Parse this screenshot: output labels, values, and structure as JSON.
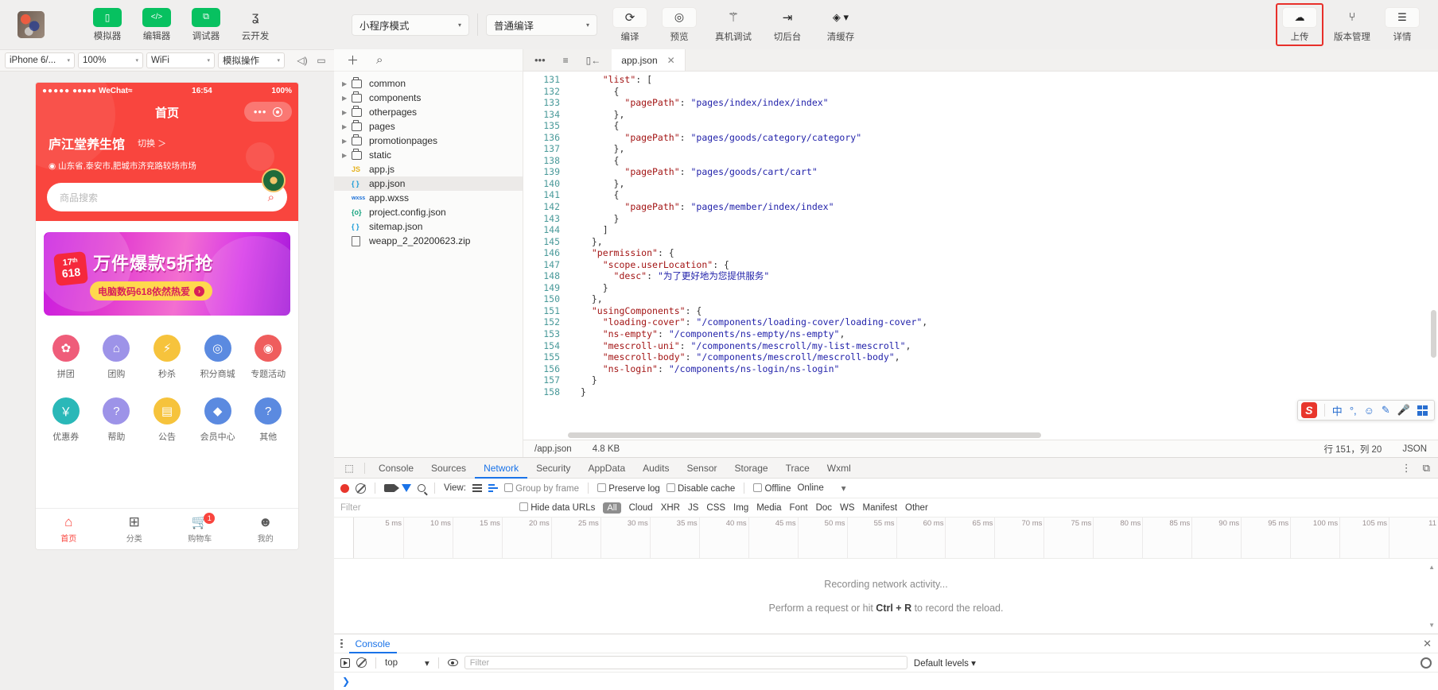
{
  "toolbar": {
    "left_tools": [
      {
        "label": "模拟器",
        "icon": "phone-icon",
        "glyph": "▯",
        "style": "green"
      },
      {
        "label": "编辑器",
        "icon": "code-icon",
        "glyph": "</>",
        "style": "green"
      },
      {
        "label": "调试器",
        "icon": "debugger-icon",
        "glyph": "⧉",
        "style": "green"
      },
      {
        "label": "云开发",
        "icon": "cloud-dev-icon",
        "glyph": "ʓ",
        "style": "plain"
      }
    ],
    "mode_select": {
      "value": "小程序模式",
      "caret": "▾"
    },
    "compile_select": {
      "value": "普通编译",
      "caret": "▾"
    },
    "mid_tools": [
      {
        "label": "编译",
        "icon": "refresh-icon",
        "glyph": "⟳"
      },
      {
        "label": "预览",
        "icon": "eye-icon",
        "glyph": "◎"
      },
      {
        "label": "真机调试",
        "icon": "bug-icon",
        "glyph": "⚚"
      },
      {
        "label": "切后台",
        "icon": "background-icon",
        "glyph": "⇥"
      },
      {
        "label": "清缓存",
        "icon": "layers-icon",
        "glyph": "◈ ▾"
      }
    ],
    "right_tools": [
      {
        "label": "上传",
        "icon": "upload-cloud-icon",
        "glyph": "☁",
        "highlighted": true
      },
      {
        "label": "版本管理",
        "icon": "branch-icon",
        "glyph": "⑂"
      },
      {
        "label": "详情",
        "icon": "menu-icon",
        "glyph": "☰"
      }
    ],
    "highlight_color": "#e8302a"
  },
  "simulator": {
    "controls": [
      {
        "value": "iPhone 6/...",
        "name": "device-select"
      },
      {
        "value": "100%",
        "name": "zoom-select"
      },
      {
        "value": "WiFi",
        "name": "network-select"
      },
      {
        "value": "模拟操作",
        "name": "simulate-action-select"
      }
    ],
    "icons": [
      "volume-icon",
      "screen-icon"
    ],
    "phone": {
      "status": {
        "carrier": "●●●●● WeChat",
        "wifi": "≈",
        "time": "16:54",
        "battery": "100%"
      },
      "nav_title": "首页",
      "shop_name": "庐江堂养生馆",
      "switch_label": "切换 ＞",
      "address": "山东省,泰安市,肥城市济兖路较场市场",
      "search_placeholder": "商品搜索",
      "banner": {
        "badge_top": "17ᵗʰ",
        "badge_bottom": "618",
        "main": "万件爆款5折抢",
        "sub": "电脑数码618依然热爱"
      },
      "grid": [
        {
          "label": "拼团",
          "color": "#ef5d7a",
          "glyph": "✿"
        },
        {
          "label": "团购",
          "color": "#9d93e8",
          "glyph": "⌂"
        },
        {
          "label": "秒杀",
          "color": "#f6c33c",
          "glyph": "⚡"
        },
        {
          "label": "积分商城",
          "color": "#5b8ae0",
          "glyph": "◎"
        },
        {
          "label": "专题活动",
          "color": "#ef5d5d",
          "glyph": "◉"
        },
        {
          "label": "优惠券",
          "color": "#2ab8b8",
          "glyph": "￥"
        },
        {
          "label": "帮助",
          "color": "#9d93e8",
          "glyph": "?"
        },
        {
          "label": "公告",
          "color": "#f6c33c",
          "glyph": "▤"
        },
        {
          "label": "会员中心",
          "color": "#5b8ae0",
          "glyph": "◆"
        },
        {
          "label": "其他",
          "color": "#5b8ae0",
          "glyph": "?"
        }
      ],
      "tabbar": [
        {
          "label": "首页",
          "glyph": "⌂",
          "active": true,
          "badge": null
        },
        {
          "label": "分类",
          "glyph": "⊞",
          "active": false,
          "badge": null
        },
        {
          "label": "购物车",
          "glyph": "🛒",
          "active": false,
          "badge": "1"
        },
        {
          "label": "我的",
          "glyph": "☻",
          "active": false,
          "badge": null
        }
      ],
      "accent": "#f9453e"
    }
  },
  "file_tree": {
    "bar_icons": [
      "add-icon",
      "search-icon"
    ],
    "items": [
      {
        "name": "common",
        "type": "folder"
      },
      {
        "name": "components",
        "type": "folder"
      },
      {
        "name": "otherpages",
        "type": "folder"
      },
      {
        "name": "pages",
        "type": "folder"
      },
      {
        "name": "promotionpages",
        "type": "folder"
      },
      {
        "name": "static",
        "type": "folder"
      },
      {
        "name": "app.js",
        "type": "js",
        "badge": "JS"
      },
      {
        "name": "app.json",
        "type": "json",
        "badge": "{ }",
        "selected": true
      },
      {
        "name": "app.wxss",
        "type": "wxss",
        "badge": "wxss"
      },
      {
        "name": "project.config.json",
        "type": "config",
        "badge": "{o}"
      },
      {
        "name": "sitemap.json",
        "type": "json",
        "badge": "{ }"
      },
      {
        "name": "weapp_2_20200623.zip",
        "type": "file",
        "badge": ""
      }
    ]
  },
  "editor": {
    "toolbar_icons": [
      "more-icon",
      "outline-icon",
      "sidebar-toggle-icon"
    ],
    "tab": {
      "label": "app.json",
      "close": "✕"
    },
    "first_line_number": 131,
    "lines": [
      "    \"list\": [",
      "      {",
      "        \"pagePath\": \"pages/index/index/index\"",
      "      },",
      "      {",
      "        \"pagePath\": \"pages/goods/category/category\"",
      "      },",
      "      {",
      "        \"pagePath\": \"pages/goods/cart/cart\"",
      "      },",
      "      {",
      "        \"pagePath\": \"pages/member/index/index\"",
      "      }",
      "    ]",
      "  },",
      "  \"permission\": {",
      "    \"scope.userLocation\": {",
      "      \"desc\": \"为了更好地为您提供服务\"",
      "    }",
      "  },",
      "  \"usingComponents\": {",
      "    \"loading-cover\": \"/components/loading-cover/loading-cover\",",
      "    \"ns-empty\": \"/components/ns-empty/ns-empty\",",
      "    \"mescroll-uni\": \"/components/mescroll/my-list-mescroll\",",
      "    \"mescroll-body\": \"/components/mescroll/mescroll-body\",",
      "    \"ns-login\": \"/components/ns-login/ns-login\"",
      "  }",
      "}"
    ],
    "status": {
      "path": "/app.json",
      "size": "4.8 KB",
      "cursor": "行 151，列 20",
      "language": "JSON"
    }
  },
  "ime": {
    "logo": "S",
    "items": [
      "中",
      "°,",
      "☺",
      "✎",
      "🎤",
      "▦"
    ]
  },
  "devtools": {
    "tabs": [
      {
        "label": "Console",
        "active": false
      },
      {
        "label": "Sources",
        "active": false
      },
      {
        "label": "Network",
        "active": true
      },
      {
        "label": "Security",
        "active": false
      },
      {
        "label": "AppData",
        "active": false
      },
      {
        "label": "Audits",
        "active": false
      },
      {
        "label": "Sensor",
        "active": false
      },
      {
        "label": "Storage",
        "active": false
      },
      {
        "label": "Trace",
        "active": false
      },
      {
        "label": "Wxml",
        "active": false
      }
    ],
    "right_icons": [
      "more-vertical-icon",
      "dock-icon"
    ],
    "network_controls": {
      "view_label": "View:",
      "group_by_frame": "Group by frame",
      "preserve_log": "Preserve log",
      "disable_cache": "Disable cache",
      "offline": "Offline",
      "online": "Online",
      "caret": "▾"
    },
    "filter_row": {
      "placeholder": "Filter",
      "hide_data_urls": "Hide data URLs",
      "types": [
        "All",
        "Cloud",
        "XHR",
        "JS",
        "CSS",
        "Img",
        "Media",
        "Font",
        "Doc",
        "WS",
        "Manifest",
        "Other"
      ],
      "active_type": "All"
    },
    "timeline_ticks": [
      "5 ms",
      "10 ms",
      "15 ms",
      "20 ms",
      "25 ms",
      "30 ms",
      "35 ms",
      "40 ms",
      "45 ms",
      "50 ms",
      "55 ms",
      "60 ms",
      "65 ms",
      "70 ms",
      "75 ms",
      "80 ms",
      "85 ms",
      "90 ms",
      "95 ms",
      "100 ms",
      "105 ms",
      "11"
    ],
    "empty_message_1": "Recording network activity...",
    "empty_message_2_pre": "Perform a request or hit ",
    "empty_message_2_key": "Ctrl + R",
    "empty_message_2_post": " to record the reload.",
    "drawer": {
      "tab": "Console",
      "close": "✕",
      "context": "top",
      "caret": "▾",
      "filter_placeholder": "Filter",
      "levels": "Default levels ▾",
      "prompt": "❯"
    }
  }
}
